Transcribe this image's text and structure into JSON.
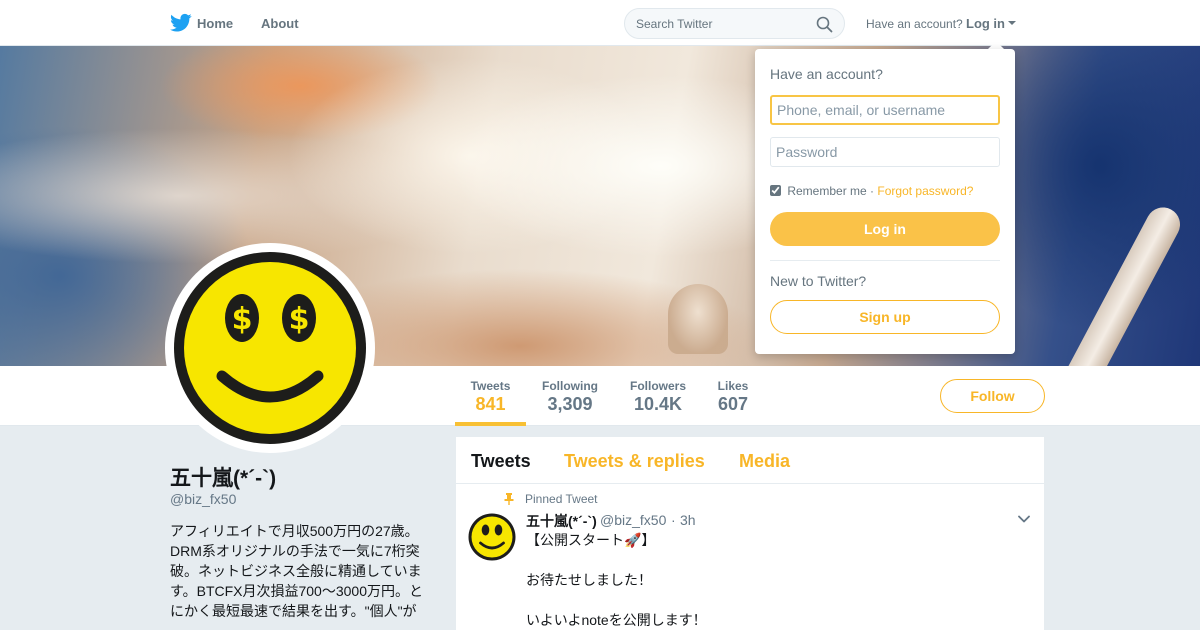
{
  "nav": {
    "logo_icon": "twitter-bird-icon",
    "home_label": "Home",
    "about_label": "About",
    "search_placeholder": "Search Twitter",
    "search_icon": "search-icon",
    "have_account": "Have an account?",
    "login_label": "Log in"
  },
  "login_dropdown": {
    "heading": "Have an account?",
    "username_placeholder": "Phone, email, or username",
    "password_placeholder": "Password",
    "remember_me": "Remember me",
    "separator": "·",
    "forgot_password": "Forgot password?",
    "login_button": "Log in",
    "new_to_twitter": "New to Twitter?",
    "signup_button": "Sign up"
  },
  "profile": {
    "name": "五十嵐(*´-`)",
    "handle": "@biz_fx50",
    "bio": "アフィリエイトで月収500万円の27歳。DRM系オリジナルの手法で一気に7桁突破。ネットビジネス全般に精通しています。BTCFX月次損益700〜3000万円。とにかく最短最速で結果を出す。\"個人\"が",
    "stats": [
      {
        "label": "Tweets",
        "value": "841"
      },
      {
        "label": "Following",
        "value": "3,309"
      },
      {
        "label": "Followers",
        "value": "10.4K"
      },
      {
        "label": "Likes",
        "value": "607"
      }
    ],
    "follow_button": "Follow"
  },
  "timeline": {
    "tabs": [
      "Tweets",
      "Tweets & replies",
      "Media"
    ],
    "pinned_label": "Pinned Tweet",
    "tweet": {
      "name": "五十嵐(*´-`)",
      "handle": "@biz_fx50",
      "dot": "·",
      "time": "3h",
      "lines": [
        "【公開スタート🚀】",
        "お待たせしました！",
        "いよいよnoteを公開します！"
      ]
    }
  },
  "colors": {
    "accent": "#f8b628",
    "twitter_blue": "#1da1f2",
    "smiley_yellow": "#f7e600"
  }
}
